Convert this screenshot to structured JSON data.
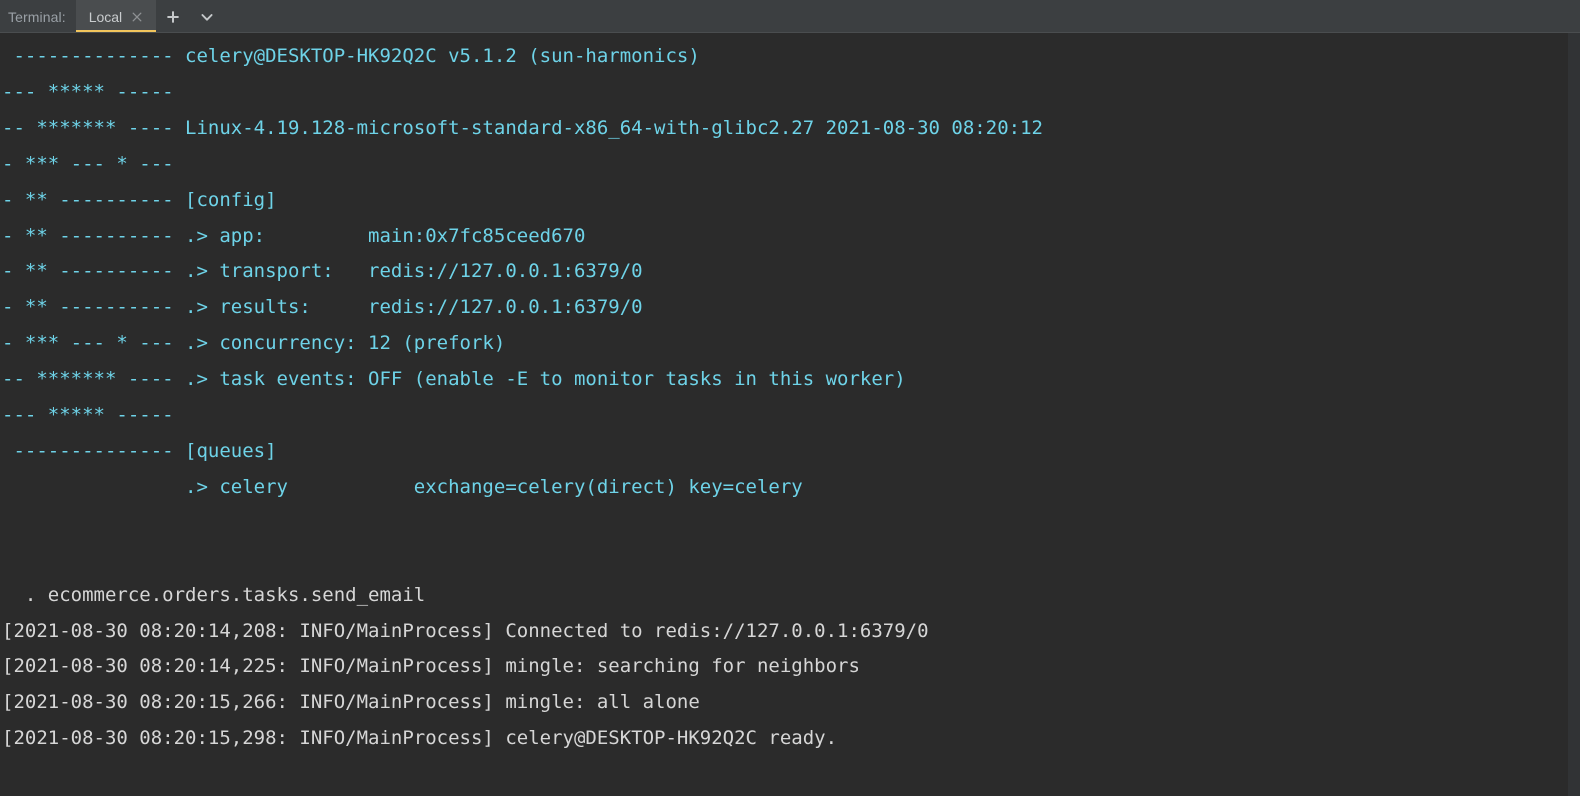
{
  "header": {
    "tool_label": "Terminal:",
    "tabs": [
      {
        "label": "Local",
        "active": true,
        "close_icon": "close-icon"
      }
    ],
    "buttons": [
      {
        "name": "new-terminal-tab-button",
        "icon": "plus-icon",
        "label": "+"
      },
      {
        "name": "terminal-options-button",
        "icon": "chevron-down-icon",
        "label": "⌄"
      }
    ]
  },
  "colors": {
    "background": "#2b2b2b",
    "header_background": "#3c3f41",
    "tab_active_background": "#4a4d4f",
    "tab_active_underline": "#f2c55c",
    "banner_text": "#6ed3e8",
    "log_text": "#d6d6d6",
    "tool_label_text": "#9aa0a6",
    "scrollbar_gutter": "#313335"
  },
  "terminal": {
    "process": "celery worker",
    "worker_name": "celery@DESKTOP-HK92Q2C",
    "celery_version": "v5.1.2",
    "celery_codename": "sun-harmonics",
    "platform": "Linux-4.19.128-microsoft-standard-x86_64-with-glibc2.27",
    "boot_timestamp": "2021-08-30 08:20:12",
    "config": {
      "app": "main:0x7fc85ceed670",
      "transport": "redis://127.0.0.1:6379/0",
      "results": "redis://127.0.0.1:6379/0",
      "concurrency": "12 (prefork)",
      "task_events": "OFF (enable -E to monitor tasks in this worker)"
    },
    "queues": [
      {
        "name": "celery",
        "binding": "exchange=celery(direct) key=celery"
      }
    ],
    "tasks": [
      "ecommerce.orders.tasks.send_email"
    ],
    "lines": [
      {
        "text": " -------------- celery@DESKTOP-HK92Q2C v5.1.2 (sun-harmonics)",
        "color": "banner"
      },
      {
        "text": "--- ***** -----",
        "color": "banner"
      },
      {
        "text": "-- ******* ---- Linux-4.19.128-microsoft-standard-x86_64-with-glibc2.27 2021-08-30 08:20:12",
        "color": "banner"
      },
      {
        "text": "- *** --- * ---",
        "color": "banner"
      },
      {
        "text": "- ** ---------- [config]",
        "color": "banner"
      },
      {
        "text": "- ** ---------- .> app:         main:0x7fc85ceed670",
        "color": "banner"
      },
      {
        "text": "- ** ---------- .> transport:   redis://127.0.0.1:6379/0",
        "color": "banner"
      },
      {
        "text": "- ** ---------- .> results:     redis://127.0.0.1:6379/0",
        "color": "banner"
      },
      {
        "text": "- *** --- * --- .> concurrency: 12 (prefork)",
        "color": "banner"
      },
      {
        "text": "-- ******* ---- .> task events: OFF (enable -E to monitor tasks in this worker)",
        "color": "banner"
      },
      {
        "text": "--- ***** -----",
        "color": "banner"
      },
      {
        "text": " -------------- [queues]",
        "color": "banner"
      },
      {
        "text": "                .> celery           exchange=celery(direct) key=celery",
        "color": "banner"
      },
      {
        "text": "",
        "color": "blank"
      },
      {
        "text": "",
        "color": "blank"
      },
      {
        "text": "  . ecommerce.orders.tasks.send_email",
        "color": "log"
      },
      {
        "text": "[2021-08-30 08:20:14,208: INFO/MainProcess] Connected to redis://127.0.0.1:6379/0",
        "color": "log"
      },
      {
        "text": "[2021-08-30 08:20:14,225: INFO/MainProcess] mingle: searching for neighbors",
        "color": "log"
      },
      {
        "text": "[2021-08-30 08:20:15,266: INFO/MainProcess] mingle: all alone",
        "color": "log"
      },
      {
        "text": "[2021-08-30 08:20:15,298: INFO/MainProcess] celery@DESKTOP-HK92Q2C ready.",
        "color": "log"
      }
    ]
  }
}
